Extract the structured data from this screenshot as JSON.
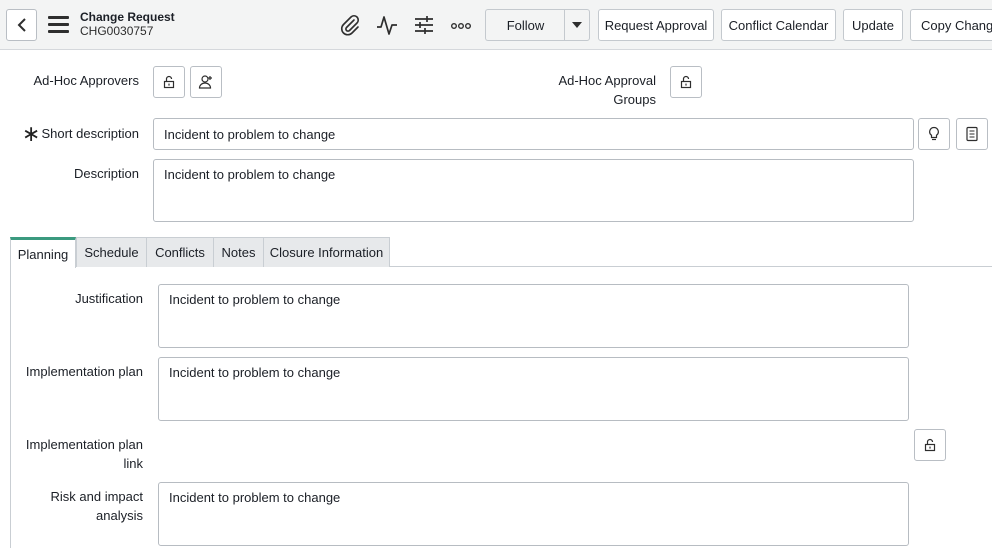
{
  "header": {
    "title": "Change Request",
    "number": "CHG0030757",
    "follow_label": "Follow",
    "buttons": {
      "request_approval": "Request Approval",
      "conflict_calendar": "Conflict Calendar",
      "update": "Update",
      "copy_change": "Copy Change"
    },
    "icons": [
      "back-icon",
      "menu-icon",
      "attachment-icon",
      "activity-icon",
      "settings-sliders-icon",
      "more-icon",
      "caret-down-icon"
    ]
  },
  "form": {
    "adhoc_approvers_label": "Ad-Hoc Approvers",
    "adhoc_groups_label_1": "Ad-Hoc Approval",
    "adhoc_groups_label_2": "Groups",
    "short_description_label": "Short description",
    "short_description_value": "Incident to problem to change",
    "description_label": "Description",
    "description_value": "Incident to problem to change"
  },
  "tabs": [
    {
      "label": "Planning",
      "active": true
    },
    {
      "label": "Schedule",
      "active": false
    },
    {
      "label": "Conflicts",
      "active": false
    },
    {
      "label": "Notes",
      "active": false
    },
    {
      "label": "Closure Information",
      "active": false
    }
  ],
  "planning": {
    "justification_label": "Justification",
    "justification_value": "Incident to problem to change",
    "implementation_plan_label": "Implementation plan",
    "implementation_plan_value": "Incident to problem to change",
    "implementation_plan_link_label_1": "Implementation plan",
    "implementation_plan_link_label_2": "link",
    "risk_label_1": "Risk and impact",
    "risk_label_2": "analysis",
    "risk_value": "Incident to problem to change"
  },
  "colors": {
    "header_bg": "#f3f4f4",
    "active_tab_accent": "#3b9a7f",
    "border": "#b7bcc2"
  }
}
